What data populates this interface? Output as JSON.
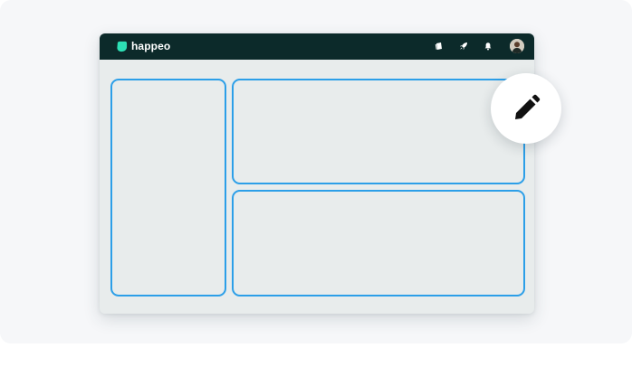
{
  "app": {
    "brand_name": "happeo",
    "brand_color": "#2de0b5",
    "topbar_color": "#0c2a2a",
    "panel_border_color": "#2c9fe8"
  },
  "topbar": {
    "icons": [
      "pages-icon",
      "rocket-icon",
      "bell-icon",
      "user-avatar"
    ]
  },
  "layout_widgets": [
    "left-column-widget",
    "top-right-widget",
    "bottom-right-widget"
  ],
  "edit_button": {
    "icon": "pencil-icon"
  }
}
